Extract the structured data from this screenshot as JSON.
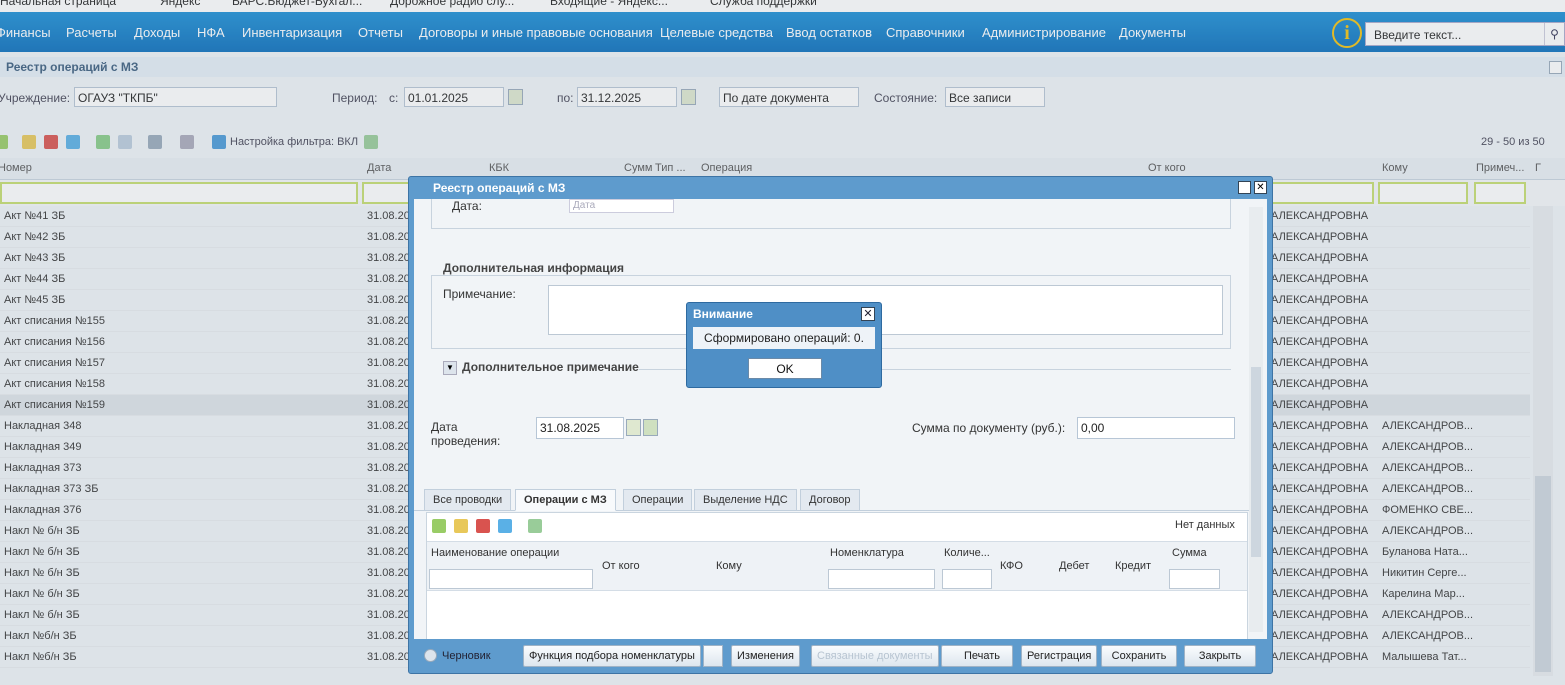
{
  "bookmarks": [
    "Начальная страница",
    "Яндекс",
    "БАРС.Бюджет-Бухгал...",
    "Дорожное радио слу...",
    "Входящие - Яндекс...",
    "Служба поддержки"
  ],
  "nav": {
    "items": [
      "Финансы",
      "Расчеты",
      "Доходы",
      "НФА",
      "Инвентаризация",
      "Отчеты",
      "Договоры и иные правовые основания",
      "Целевые средства",
      "Ввод остатков",
      "Справочники",
      "Администрирование",
      "Документы"
    ],
    "info_glyph": "i",
    "search_placeholder": "Введите текст..."
  },
  "page": {
    "title": "Реестр операций с МЗ",
    "institution_label": "Учреждение:",
    "institution_value": "ОГАУЗ \"ТКПБ\"",
    "period_label": "Период:",
    "from_label": "с:",
    "from_value": "01.01.2025",
    "to_label": "по:",
    "to_value": "31.12.2025",
    "date_mode": "По дате документа",
    "state_label": "Состояние:",
    "state_value": "Все записи",
    "filter_label": "Настройка фильтра: ВКЛ",
    "paging": "29 - 50 из 50"
  },
  "grid": {
    "columns": [
      "Номер",
      "Дата",
      "КБК",
      "Сумм",
      "Тип ...",
      "Операция",
      "От кого",
      "Кому",
      "Примеч...",
      "Г"
    ],
    "rows": [
      {
        "num": "Акт №41 ЗБ",
        "date": "31.08.20",
        "from": "АЛЕКСАНДРОВНА",
        "to": ""
      },
      {
        "num": "Акт №42 ЗБ",
        "date": "31.08.20",
        "from": "АЛЕКСАНДРОВНА",
        "to": ""
      },
      {
        "num": "Акт №43 ЗБ",
        "date": "31.08.20",
        "from": "АЛЕКСАНДРОВНА",
        "to": ""
      },
      {
        "num": "Акт №44 ЗБ",
        "date": "31.08.20",
        "from": "АЛЕКСАНДРОВНА",
        "to": ""
      },
      {
        "num": "Акт №45 ЗБ",
        "date": "31.08.20",
        "from": "АЛЕКСАНДРОВНА",
        "to": ""
      },
      {
        "num": "Акт списания №155",
        "date": "31.08.20",
        "from": "АЛЕКСАНДРОВНА",
        "to": ""
      },
      {
        "num": "Акт списания №156",
        "date": "31.08.20",
        "from": "АЛЕКСАНДРОВНА",
        "to": ""
      },
      {
        "num": "Акт списания №157",
        "date": "31.08.20",
        "from": "АЛЕКСАНДРОВНА",
        "to": ""
      },
      {
        "num": "Акт списания №158",
        "date": "31.08.20",
        "from": "АЛЕКСАНДРОВНА",
        "to": ""
      },
      {
        "num": "Акт списания №159",
        "date": "31.08.20",
        "from": "АЛЕКСАНДРОВНА",
        "to": ""
      },
      {
        "num": "Накладная 348",
        "date": "31.08.20",
        "from": "АЛЕКСАНДРОВНА",
        "to": "АЛЕКСАНДРОВ..."
      },
      {
        "num": "Накладная 349",
        "date": "31.08.20",
        "from": "АЛЕКСАНДРОВНА",
        "to": "АЛЕКСАНДРОВ..."
      },
      {
        "num": "Накладная 373",
        "date": "31.08.20",
        "from": "АЛЕКСАНДРОВНА",
        "to": "АЛЕКСАНДРОВ..."
      },
      {
        "num": "Накладная 373 ЗБ",
        "date": "31.08.20",
        "from": "АЛЕКСАНДРОВНА",
        "to": "АЛЕКСАНДРОВ..."
      },
      {
        "num": "Накладная 376",
        "date": "31.08.20",
        "from": "АЛЕКСАНДРОВНА",
        "to": "ФОМЕНКО СВЕ..."
      },
      {
        "num": "Накл № б/н ЗБ",
        "date": "31.08.20",
        "from": "АЛЕКСАНДРОВНА",
        "to": "АЛЕКСАНДРОВ..."
      },
      {
        "num": "Накл № б/н ЗБ",
        "date": "31.08.20",
        "from": "АЛЕКСАНДРОВНА",
        "to": "Буланова Ната..."
      },
      {
        "num": "Накл № б/н ЗБ",
        "date": "31.08.20",
        "from": "АЛЕКСАНДРОВНА",
        "to": "Никитин Серге..."
      },
      {
        "num": "Накл № б/н ЗБ",
        "date": "31.08.20",
        "from": "АЛЕКСАНДРОВНА",
        "to": "Карелина Мар..."
      },
      {
        "num": "Накл № б/н ЗБ",
        "date": "31.08.20",
        "from": "АЛЕКСАНДРОВНА",
        "to": "АЛЕКСАНДРОВ..."
      },
      {
        "num": "Накл №б/н ЗБ",
        "date": "31.08.20",
        "from": "АЛЕКСАНДРОВНА",
        "to": "АЛЕКСАНДРОВ..."
      },
      {
        "num": "Накл №б/н ЗБ",
        "date": "31.08.20",
        "from": "АЛЕКСАНДРОВНА",
        "to": "Малышева Тат..."
      }
    ]
  },
  "modal": {
    "title": "Реестр операций с МЗ",
    "date_label": "Дата:",
    "date_placeholder": "Дата",
    "addinfo_legend": "Дополнительная информация",
    "note_label": "Примечание:",
    "extra_note_legend": "Дополнительное примечание",
    "posting_date_label": "Дата проведения:",
    "posting_date_value": "31.08.2025",
    "sum_label": "Сумма по документу (руб.):",
    "sum_value": "0,00",
    "tabs": [
      "Все проводки",
      "Операции с МЗ",
      "Операции",
      "Выделение НДС",
      "Договор"
    ],
    "no_data": "Нет данных",
    "columns": [
      "Наименование операции",
      "От кого",
      "Кому",
      "Номенклатура",
      "Количе...",
      "КФО",
      "Дебет",
      "Кредит",
      "Сумма"
    ],
    "draft_label": "Черновик",
    "buttons": [
      "Функция подбора номенклатуры",
      "Изменения",
      "Связанные документы",
      "Печать",
      "Регистрация",
      "Сохранить",
      "Закрыть"
    ]
  },
  "alert": {
    "title": "Внимание",
    "message": "Сформировано операций: 0.",
    "ok": "OK"
  }
}
